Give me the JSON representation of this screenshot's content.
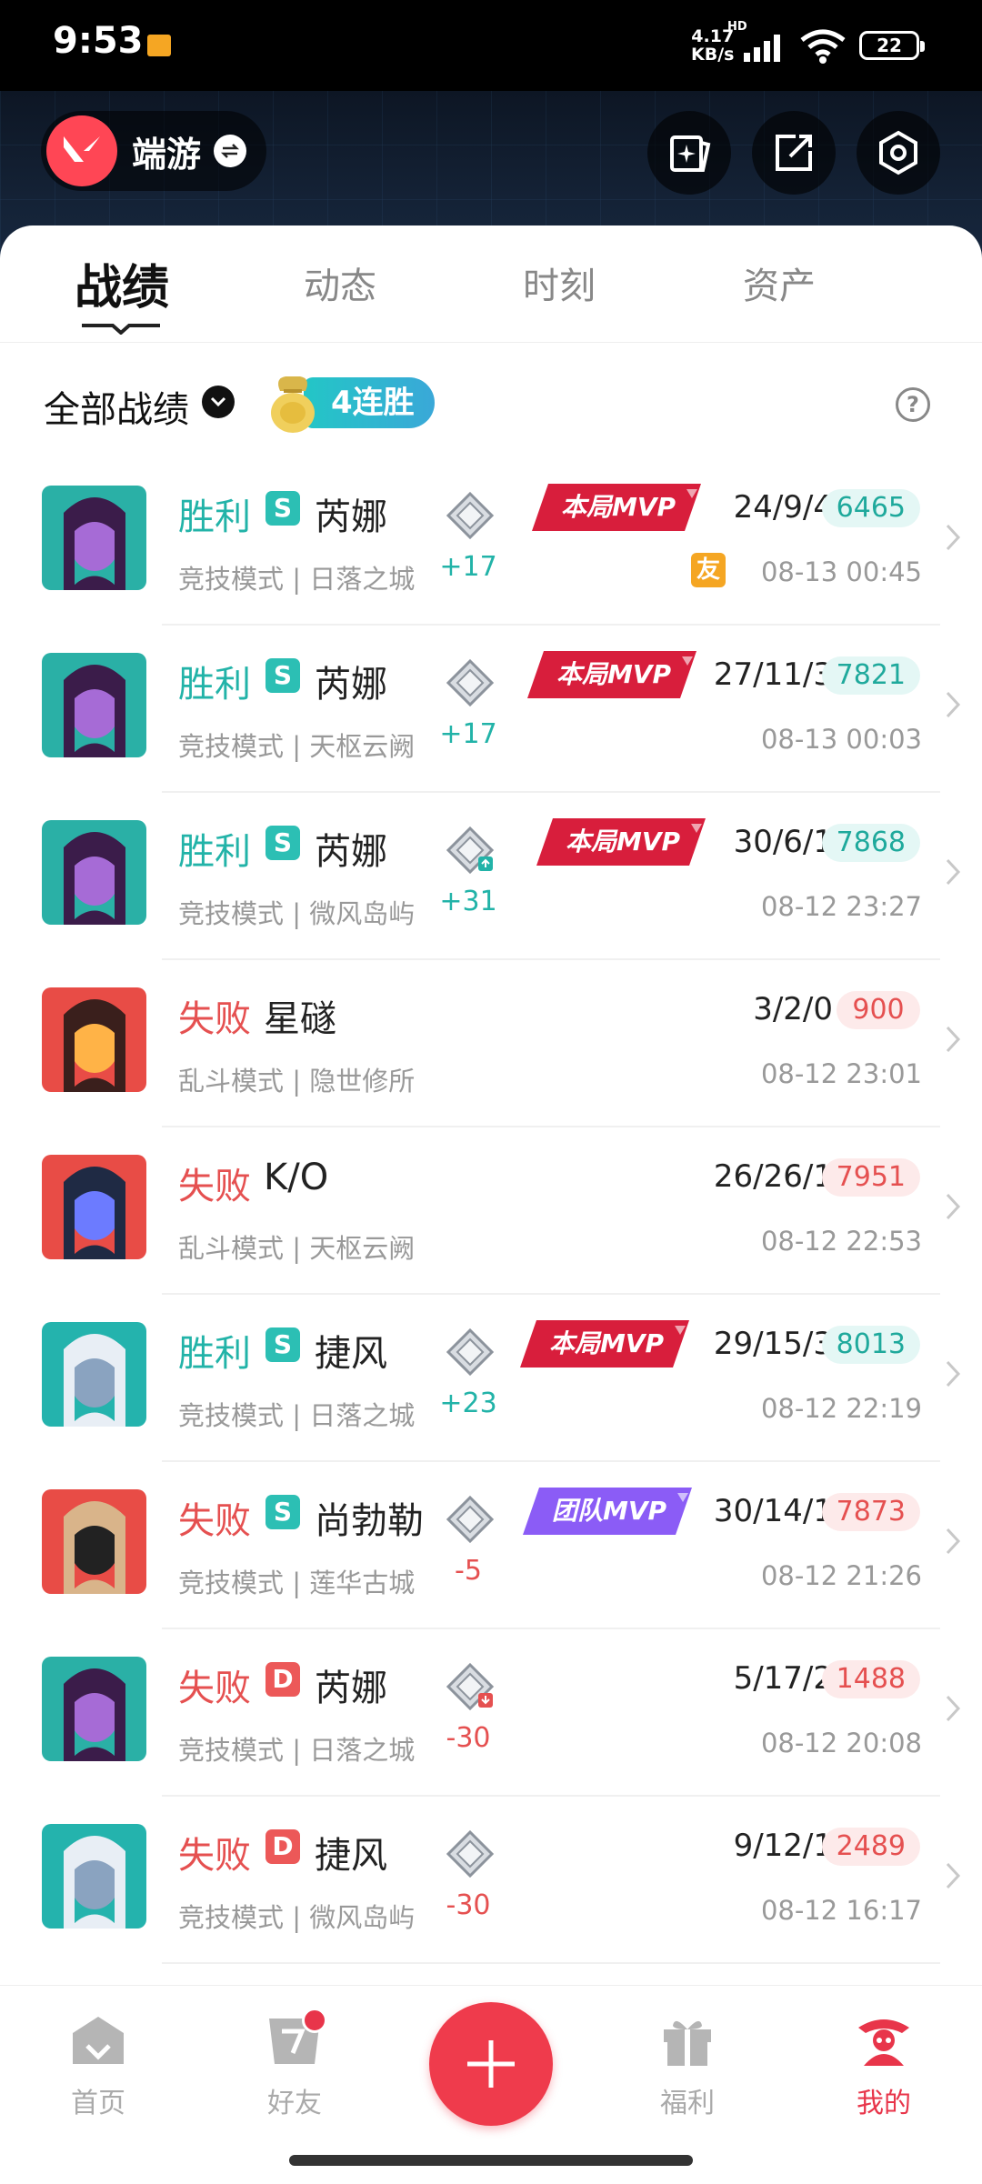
{
  "status_bar": {
    "time": "9:53",
    "net_speed_value": "4.17",
    "net_speed_unit": "KB/s",
    "network": "HD",
    "battery": "22"
  },
  "header": {
    "game_name": "端游"
  },
  "tabs": [
    {
      "label": "战绩",
      "active": true
    },
    {
      "label": "动态",
      "active": false
    },
    {
      "label": "时刻",
      "active": false
    },
    {
      "label": "资产",
      "active": false
    }
  ],
  "filter": {
    "label": "全部战绩",
    "streak_label": "4连胜"
  },
  "matches": [
    {
      "result": "胜利",
      "rank_letter": "S",
      "agent": "芮娜",
      "mode": "竞技模式",
      "map": "日落之城",
      "rr": "+17",
      "mvp": "本局MVP",
      "kda": "24/9/4",
      "score": "6465",
      "time": "08-13 00:45",
      "friend_tag": "友"
    },
    {
      "result": "胜利",
      "rank_letter": "S",
      "agent": "芮娜",
      "mode": "竞技模式",
      "map": "天枢云阙",
      "rr": "+17",
      "mvp": "本局MVP",
      "kda": "27/11/3",
      "score": "7821",
      "time": "08-13 00:03"
    },
    {
      "result": "胜利",
      "rank_letter": "S",
      "agent": "芮娜",
      "mode": "竞技模式",
      "map": "微风岛屿",
      "rr": "+31",
      "mvp": "本局MVP",
      "kda": "30/6/1",
      "score": "7868",
      "time": "08-12 23:27"
    },
    {
      "result": "失败",
      "agent": "星礈",
      "mode": "乱斗模式",
      "map": "隐世修所",
      "kda": "3/2/0",
      "score": "900",
      "time": "08-12 23:01"
    },
    {
      "result": "失败",
      "agent": "K/O",
      "mode": "乱斗模式",
      "map": "天枢云阙",
      "kda": "26/26/1",
      "score": "7951",
      "time": "08-12 22:53"
    },
    {
      "result": "胜利",
      "rank_letter": "S",
      "agent": "捷风",
      "mode": "竞技模式",
      "map": "日落之城",
      "rr": "+23",
      "mvp": "本局MVP",
      "kda": "29/15/3",
      "score": "8013",
      "time": "08-12 22:19"
    },
    {
      "result": "失败",
      "rank_letter": "S",
      "agent": "尚勃勒",
      "mode": "竞技模式",
      "map": "莲华古城",
      "rr": "-5",
      "mvp": "团队MVP",
      "kda": "30/14/1",
      "score": "7873",
      "time": "08-12 21:26"
    },
    {
      "result": "失败",
      "rank_letter": "D",
      "agent": "芮娜",
      "mode": "竞技模式",
      "map": "日落之城",
      "rr": "-30",
      "kda": "5/17/2",
      "score": "1488",
      "time": "08-12 20:08"
    },
    {
      "result": "失败",
      "rank_letter": "D",
      "agent": "捷风",
      "mode": "竞技模式",
      "map": "微风岛屿",
      "rr": "-30",
      "kda": "9/12/1",
      "score": "2489",
      "time": "08-12 16:17"
    }
  ],
  "bottom_nav": [
    {
      "label": "首页",
      "icon": "home-icon"
    },
    {
      "label": "好友",
      "icon": "friends-icon"
    },
    {
      "label": "福利",
      "icon": "gift-icon"
    },
    {
      "label": "我的",
      "icon": "profile-icon",
      "active": true
    }
  ],
  "colors": {
    "accent": "#e8354a",
    "win": "#22b3a8",
    "loss": "#e55050",
    "mvp_red": "#d81e3c",
    "mvp_team": "#8b5cf6"
  }
}
